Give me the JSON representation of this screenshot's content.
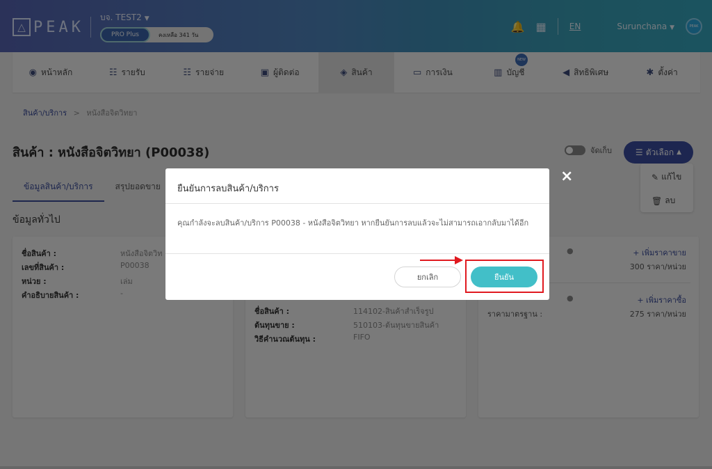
{
  "header": {
    "logo_text": "PEAK",
    "company": "บจ. TEST2",
    "plan": "PRO Plus",
    "remaining": "คงเหลือ 341 วัน",
    "lang": "EN",
    "user": "Surunchana",
    "avatar_text": "PEAK"
  },
  "nav": {
    "items": [
      {
        "label": "หน้าหลัก",
        "icon": "gauge-icon"
      },
      {
        "label": "รายรับ",
        "icon": "income-icon"
      },
      {
        "label": "รายจ่าย",
        "icon": "expense-icon"
      },
      {
        "label": "ผู้ติดต่อ",
        "icon": "contacts-icon"
      },
      {
        "label": "สินค้า",
        "icon": "cube-icon"
      },
      {
        "label": "การเงิน",
        "icon": "money-icon"
      },
      {
        "label": "บัญชี",
        "icon": "ledger-icon"
      },
      {
        "label": "สิทธิพิเศษ",
        "icon": "megaphone-icon"
      },
      {
        "label": "ตั้งค่า",
        "icon": "gear-icon"
      }
    ],
    "new_badge": "NEW"
  },
  "breadcrumb": {
    "parent": "สินค้า/บริการ",
    "separator": ">",
    "current": "หนังสือจิตวิทยา"
  },
  "page": {
    "title": "สินค้า : หนังสือจิตวิทยา (P00038)",
    "archive_label": "จัดเก็บ",
    "options_label": "ตัวเลือก",
    "dropdown": {
      "edit": "แก้ไข",
      "delete": "ลบ"
    }
  },
  "tabs": [
    "ข้อมูลสินค้า/บริการ",
    "สรุปยอดขาย"
  ],
  "section_title": "ข้อมูลทั่วไป",
  "general_card": {
    "rows": [
      {
        "k": "ชื่อสินค้า :",
        "v": "หนังสือจิตวิท"
      },
      {
        "k": "เลขที่สินค้า :",
        "v": "P00038"
      },
      {
        "k": "หน่วย :",
        "v": "เล่ม"
      },
      {
        "k": "คำอธิบายสินค้า :",
        "v": "-"
      }
    ]
  },
  "account_card": {
    "rows": [
      {
        "k": "ชื่อสินค้า :",
        "v": "114102-สินค้าสำเร็จรูป"
      },
      {
        "k": "ต้นทุนขาย :",
        "v": "510103-ต้นทุนขายสินค้า"
      },
      {
        "k": "วิธีคำนวณต้นทุน :",
        "v": "FIFO"
      }
    ]
  },
  "price_card": {
    "add_sell": "+ เพิ่มราคาขาย",
    "sell_count": "300 ราคา/หน่วย",
    "add_buy": "+ เพิ่มราคาซื้อ",
    "std_price_label": "ราคามาตรฐาน :",
    "buy_count": "275 ราคา/หน่วย"
  },
  "modal": {
    "title": "ยืนยันการลบสินค้า/บริการ",
    "body": "คุณกำลังจะลบสินค้า/บริการ P00038 - หนังสือจิตวิทยา หากยืนยันการลบแล้วจะไม่สามารถเอากลับมาได้อีก",
    "cancel": "ยกเลิก",
    "confirm": "ยืนยัน",
    "close": "×"
  },
  "colors": {
    "primary": "#3a4ca0",
    "confirm": "#42bfc8",
    "highlight": "#e0191f"
  }
}
